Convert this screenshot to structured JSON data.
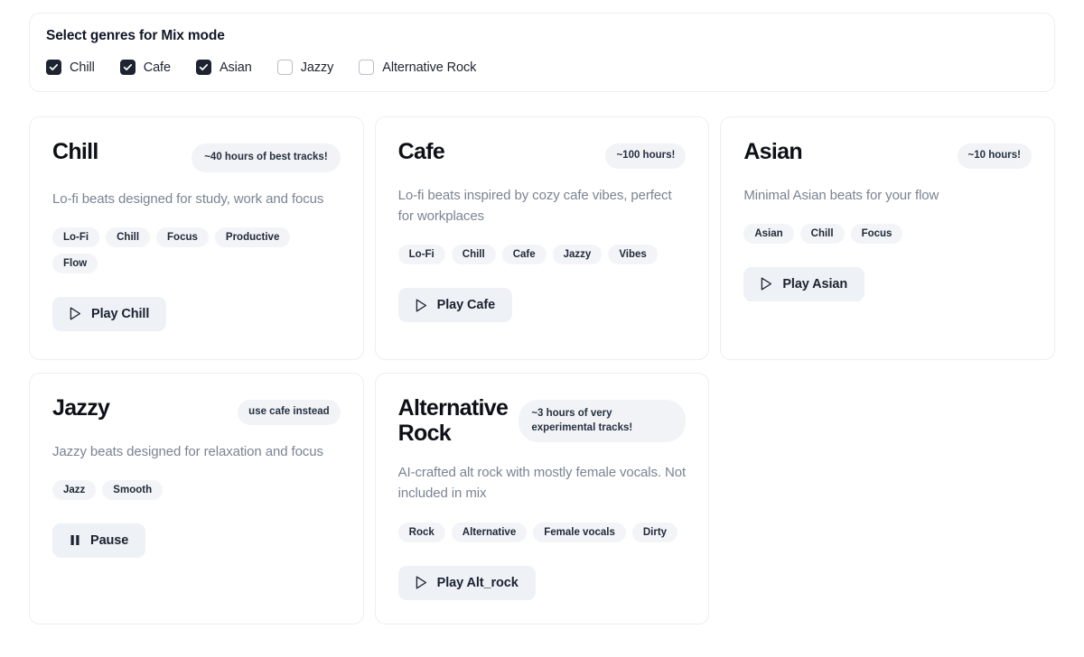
{
  "selector": {
    "title": "Select genres for Mix mode",
    "options": [
      {
        "label": "Chill",
        "checked": true,
        "icon": "checkbox-checked-icon"
      },
      {
        "label": "Cafe",
        "checked": true,
        "icon": "checkbox-checked-icon"
      },
      {
        "label": "Asian",
        "checked": true,
        "icon": "checkbox-checked-icon"
      },
      {
        "label": "Jazzy",
        "checked": false,
        "icon": "checkbox-unchecked-icon"
      },
      {
        "label": "Alternative Rock",
        "checked": false,
        "icon": "checkbox-unchecked-icon"
      }
    ]
  },
  "cards": [
    {
      "title": "Chill",
      "badge": "~40 hours of best tracks!",
      "description": "Lo-fi beats designed for study, work and focus",
      "tags": [
        "Lo-Fi",
        "Chill",
        "Focus",
        "Productive",
        "Flow"
      ],
      "action_label": "Play Chill",
      "action_icon": "play-icon"
    },
    {
      "title": "Cafe",
      "badge": "~100 hours!",
      "description": "Lo-fi beats inspired by cozy cafe vibes, perfect for workplaces",
      "tags": [
        "Lo-Fi",
        "Chill",
        "Cafe",
        "Jazzy",
        "Vibes"
      ],
      "action_label": "Play Cafe",
      "action_icon": "play-icon"
    },
    {
      "title": "Asian",
      "badge": "~10 hours!",
      "description": "Minimal Asian beats for your flow",
      "tags": [
        "Asian",
        "Chill",
        "Focus"
      ],
      "action_label": "Play Asian",
      "action_icon": "play-icon"
    },
    {
      "title": "Jazzy",
      "badge": "use cafe instead",
      "description": "Jazzy beats designed for relaxation and focus",
      "tags": [
        "Jazz",
        "Smooth"
      ],
      "action_label": "Pause",
      "action_icon": "pause-icon"
    },
    {
      "title": "Alternative Rock",
      "badge": "~3 hours of very experimental tracks!",
      "description": "AI-crafted alt rock with mostly female vocals. Not included in mix",
      "tags": [
        "Rock",
        "Alternative",
        "Female vocals",
        "Dirty"
      ],
      "action_label": "Play Alt_rock",
      "action_icon": "play-icon"
    }
  ],
  "colors": {
    "page_background": "#ffffff",
    "card_border": "#eceef1",
    "title_text": "#0d1117",
    "description_text": "#7b8493",
    "badge_background": "#f1f3f7",
    "tag_background": "#f2f4f8",
    "button_background": "#eef1f6",
    "checkbox_checked": "#1d2330",
    "checkbox_border": "#b9bfc9"
  }
}
